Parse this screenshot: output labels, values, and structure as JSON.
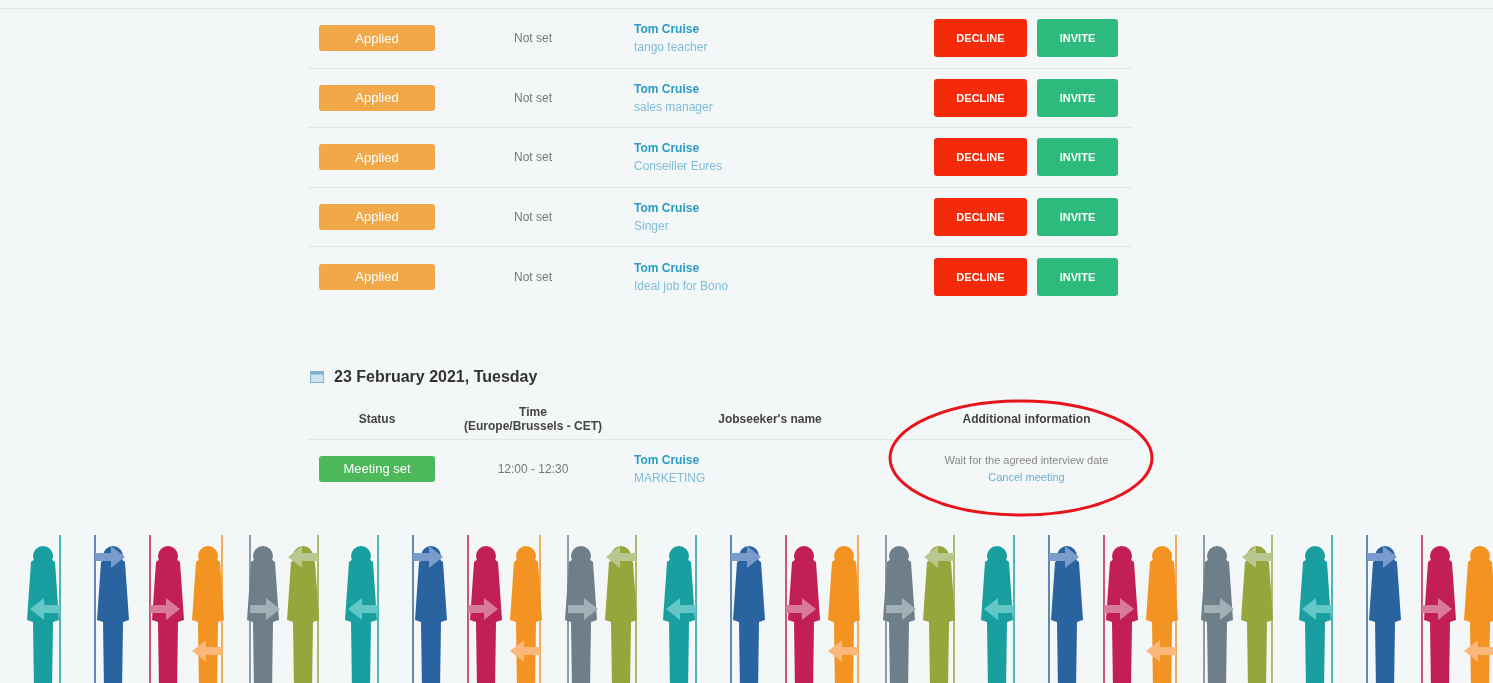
{
  "applications": [
    {
      "status": "Applied",
      "kind": "applied",
      "time": "Not set",
      "name": "Tom Cruise",
      "job": "tango teacher",
      "actions": [
        {
          "label": "DECLINE",
          "kind": "decline"
        },
        {
          "label": "INVITE",
          "kind": "invite"
        }
      ]
    },
    {
      "status": "Applied",
      "kind": "applied",
      "time": "Not set",
      "name": "Tom Cruise",
      "job": "sales manager",
      "actions": [
        {
          "label": "DECLINE",
          "kind": "decline"
        },
        {
          "label": "INVITE",
          "kind": "invite"
        }
      ]
    },
    {
      "status": "Applied",
      "kind": "applied",
      "time": "Not set",
      "name": "Tom Cruise",
      "job": "Conseiller Eures",
      "actions": [
        {
          "label": "DECLINE",
          "kind": "decline"
        },
        {
          "label": "INVITE",
          "kind": "invite"
        }
      ]
    },
    {
      "status": "Applied",
      "kind": "applied",
      "time": "Not set",
      "name": "Tom Cruise",
      "job": "Singer",
      "actions": [
        {
          "label": "DECLINE",
          "kind": "decline"
        },
        {
          "label": "INVITE",
          "kind": "invite"
        }
      ]
    },
    {
      "status": "Applied",
      "kind": "applied",
      "time": "Not set",
      "name": "Tom Cruise",
      "job": "Ideal job for Bono",
      "actions": [
        {
          "label": "DECLINE",
          "kind": "decline"
        },
        {
          "label": "INVITE",
          "kind": "invite"
        }
      ]
    }
  ],
  "day": {
    "date": "23 February 2021, Tuesday",
    "columns": [
      "Status",
      "Time\n(Europe/Brussels - CET)",
      "Jobseeker's name",
      "Additional information"
    ],
    "rows": [
      {
        "status": "Meeting set",
        "kind": "meeting_set",
        "time": "12:00 - 12:30",
        "name": "Tom Cruise",
        "job": "MARKETING",
        "info": "Wait for the agreed interview date",
        "link": "Cancel meeting"
      }
    ]
  }
}
